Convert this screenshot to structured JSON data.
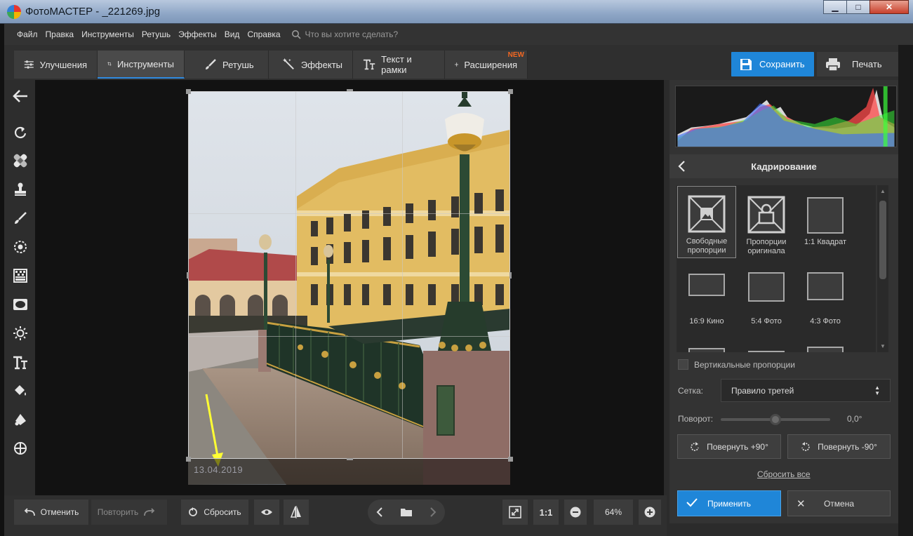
{
  "window": {
    "title": "ФотоМАСТЕР - _221269.jpg",
    "minimize": "▁",
    "maximize": "□",
    "close": "✕"
  },
  "menu": {
    "items": [
      "Файл",
      "Правка",
      "Инструменты",
      "Ретушь",
      "Эффекты",
      "Вид",
      "Справка"
    ],
    "search_placeholder": "Что вы хотите сделать?"
  },
  "tabs": [
    {
      "label": "Улучшения",
      "icon": "sliders-icon"
    },
    {
      "label": "Инструменты",
      "icon": "crop-icon",
      "active": true
    },
    {
      "label": "Ретушь",
      "icon": "brush-icon"
    },
    {
      "label": "Эффекты",
      "icon": "magic-wand-icon"
    },
    {
      "label": "Текст и рамки",
      "icon": "text-icon"
    },
    {
      "label": "Расширения",
      "icon": "plus-icon",
      "badge": "NEW"
    }
  ],
  "toolbar": {
    "save_label": "Сохранить",
    "print_label": "Печать"
  },
  "left_tools": [
    "back-arrow-icon",
    "rotate-icon",
    "bandage-icon",
    "stamp-icon",
    "brush-icon",
    "radial-icon",
    "gradient-icon",
    "vignette-icon",
    "light-icon",
    "text-icon",
    "fill-icon",
    "lasso-icon",
    "target-icon"
  ],
  "canvas": {
    "date_stamp": "13.04.2019"
  },
  "crop_panel": {
    "title": "Кадрирование",
    "presets": [
      {
        "label_line1": "Свободные",
        "label_line2": "пропорции",
        "selected": true
      },
      {
        "label_line1": "Пропорции",
        "label_line2": "оригинала"
      },
      {
        "label_line1": "1:1 Квадрат",
        "label_line2": ""
      },
      {
        "label_line1": "16:9 Кино",
        "label_line2": ""
      },
      {
        "label_line1": "5:4 Фото",
        "label_line2": ""
      },
      {
        "label_line1": "4:3 Фото",
        "label_line2": ""
      }
    ],
    "vertical_label": "Вертикальные пропорции",
    "grid_label": "Сетка:",
    "grid_value": "Правило третей",
    "rotation_label": "Поворот:",
    "rotation_value": "0,0°",
    "rotation_level": 0.5,
    "rotate_plus": "Повернуть +90°",
    "rotate_minus": "Повернуть -90°",
    "reset_all": "Сбросить все",
    "apply": "Применить",
    "cancel": "Отмена"
  },
  "bottom": {
    "undo": "Отменить",
    "redo": "Повторить",
    "reset": "Сбросить",
    "zoom_one": "1:1",
    "zoom_value": "64%"
  },
  "colors": {
    "accent": "#1f86d8",
    "new_badge": "#f26722",
    "arrow_annotation": "#ffff33"
  }
}
